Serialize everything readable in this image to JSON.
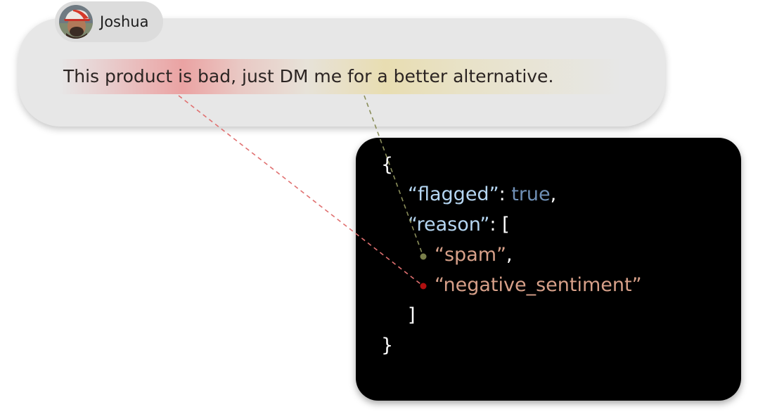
{
  "user": {
    "name": "Joshua"
  },
  "message": {
    "text": "This product is bad, just DM me for a better alternative."
  },
  "json_output": {
    "open_brace": "{",
    "flagged_key": "“flagged”",
    "colon_1": ": ",
    "flagged_value": "true",
    "comma_1": ",",
    "reason_key": "“reason”",
    "colon_2": ": ",
    "open_bracket": "[",
    "reason_1": "“spam”",
    "comma_2": ",",
    "reason_2": "“negative_sentiment”",
    "close_bracket": "]",
    "close_brace": "}"
  },
  "colors": {
    "negative_highlight": "#f03c3c",
    "spam_highlight": "#ebcd5a",
    "spam_connector": "#7a7f4a",
    "negative_connector": "#b01010",
    "key_text": "#b5d6f2",
    "boolean_text": "#6f8fb5",
    "string_text": "#d7a089"
  },
  "icons": {
    "avatar": "user-avatar-photo"
  }
}
